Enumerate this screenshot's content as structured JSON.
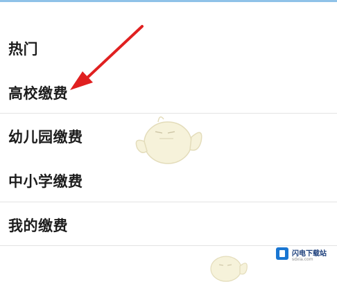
{
  "menu": {
    "items": [
      {
        "label": "热门"
      },
      {
        "label": "高校缴费"
      },
      {
        "label": "幼儿园缴费"
      },
      {
        "label": "中小学缴费"
      },
      {
        "label": "我的缴费"
      }
    ]
  },
  "watermark": {
    "brand": "闪电下载站",
    "domain": "sdxia.com"
  },
  "colors": {
    "arrow": "#e02020",
    "top_strip": "#8fc2e8",
    "divider": "#e3e3e3",
    "watermark_logo": "#1976d2"
  }
}
